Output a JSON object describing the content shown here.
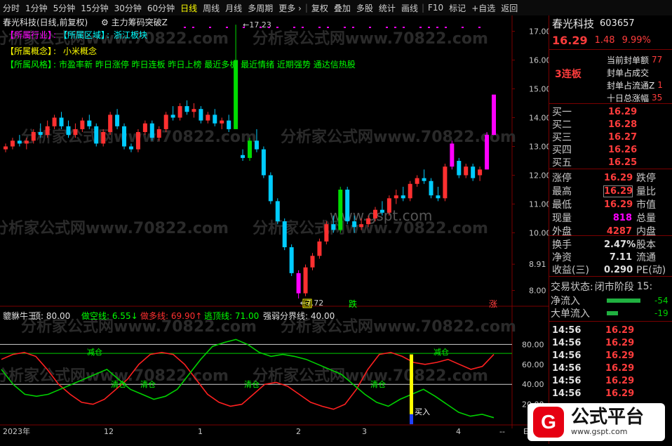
{
  "toolbar": {
    "items": [
      "分时",
      "1分钟",
      "5分钟",
      "15分钟",
      "30分钟",
      "60分钟",
      "日线",
      "周线",
      "月线",
      "多周期",
      "更多",
      "复权",
      "叠加",
      "多股",
      "统计",
      "画线",
      "F10",
      "标记",
      "+自选",
      "返回"
    ],
    "active_index": 6,
    "more_arrow": "›"
  },
  "main_chart": {
    "title": "春光科技(日线,前复权)",
    "indicator_name": "主力筹码突破Z",
    "info_lines": [
      {
        "key": "【所属行业】",
        "sep": ":",
        "key2": "【所属区域】",
        "sep2": ":",
        "value": "浙江板块"
      },
      {
        "key": "【所属概念】",
        "sep": ":",
        "value": "小米概念"
      },
      {
        "key": "【所属风格】",
        "sep": ":",
        "value": "市盈率新 昨日涨停 昨日连板 昨日上榜 最近多板 最近情绪 近期强势 通达信热股"
      }
    ],
    "price_axis": [
      "17.00",
      "16.00",
      "15.00",
      "14.00",
      "13.00",
      "12.00",
      "11.00",
      "10.00",
      "8.91",
      "8.00"
    ],
    "high_label": "17.23",
    "low_label": "7.72",
    "markers": {
      "hui": "回",
      "die": "跌",
      "zhang": "涨"
    },
    "watermarks": [
      "分析家公式网www.70822.com",
      "www.gspt.com"
    ],
    "colors": {
      "up": "#ff3030",
      "down": "#00ccff",
      "limit": "#ff00ff",
      "green": "#00dd00"
    }
  },
  "chart_data": {
    "type": "candlestick",
    "x": [
      "2023年",
      "12",
      "1",
      "2",
      "3",
      "4"
    ],
    "ylim": [
      7.5,
      17.5
    ],
    "high": 17.23,
    "low": 7.72,
    "series": [
      {
        "name": "",
        "values": [
          [
            12.9,
            13.1,
            12.8,
            13.0
          ],
          [
            13.0,
            13.3,
            12.9,
            13.2
          ],
          [
            13.2,
            13.4,
            13.0,
            13.1
          ],
          [
            13.1,
            13.3,
            12.9,
            13.2
          ],
          [
            13.2,
            13.6,
            13.1,
            13.5
          ],
          [
            13.5,
            13.8,
            13.3,
            13.4
          ],
          [
            13.4,
            13.9,
            13.3,
            13.7
          ],
          [
            13.7,
            14.1,
            13.6,
            14.0
          ],
          [
            14.0,
            14.2,
            13.6,
            13.7
          ],
          [
            13.7,
            13.9,
            13.3,
            13.4
          ],
          [
            13.4,
            13.8,
            13.3,
            13.6
          ],
          [
            13.6,
            14.0,
            13.5,
            13.9
          ],
          [
            13.9,
            14.1,
            13.6,
            13.7
          ],
          [
            13.7,
            13.8,
            13.0,
            13.1
          ],
          [
            13.1,
            13.6,
            13.0,
            13.5
          ],
          [
            13.5,
            14.2,
            13.4,
            14.1
          ],
          [
            14.1,
            14.3,
            13.6,
            13.7
          ],
          [
            13.7,
            13.8,
            12.9,
            13.0
          ],
          [
            13.0,
            13.1,
            12.8,
            12.9
          ],
          [
            12.9,
            13.6,
            12.8,
            13.5
          ],
          [
            13.5,
            13.9,
            13.4,
            13.8
          ],
          [
            13.8,
            13.9,
            13.2,
            13.3
          ],
          [
            13.3,
            13.7,
            13.2,
            13.6
          ],
          [
            13.6,
            14.2,
            13.5,
            14.1
          ],
          [
            14.1,
            14.4,
            13.9,
            14.0
          ],
          [
            14.0,
            14.5,
            13.9,
            14.4
          ],
          [
            14.4,
            14.6,
            14.1,
            14.2
          ],
          [
            14.2,
            14.5,
            14.0,
            14.3
          ],
          [
            14.3,
            14.4,
            13.8,
            13.9
          ],
          [
            13.9,
            14.2,
            13.8,
            14.1
          ],
          [
            14.1,
            14.3,
            13.7,
            13.8
          ],
          [
            13.8,
            14.0,
            13.6,
            13.9
          ],
          [
            13.9,
            14.1,
            13.5,
            13.6
          ],
          [
            13.6,
            17.23,
            13.6,
            16.0
          ],
          [
            12.7,
            12.9,
            12.5,
            12.6
          ],
          [
            12.6,
            13.3,
            12.5,
            13.2
          ],
          [
            13.2,
            13.6,
            12.8,
            12.9
          ],
          [
            12.9,
            13.0,
            11.9,
            12.0
          ],
          [
            12.0,
            12.1,
            11.0,
            11.1
          ],
          [
            11.1,
            11.2,
            10.3,
            10.4
          ],
          [
            10.4,
            10.5,
            9.4,
            9.5
          ],
          [
            9.5,
            9.6,
            8.5,
            8.6
          ],
          [
            8.6,
            8.7,
            7.72,
            7.9
          ],
          [
            7.9,
            8.9,
            7.8,
            8.8
          ],
          [
            8.8,
            9.3,
            8.7,
            9.2
          ],
          [
            9.2,
            9.8,
            9.1,
            9.7
          ],
          [
            9.7,
            10.4,
            9.6,
            10.3
          ],
          [
            10.3,
            10.6,
            10.0,
            10.1
          ],
          [
            10.1,
            11.6,
            10.0,
            11.5
          ],
          [
            11.5,
            11.6,
            10.3,
            10.4
          ],
          [
            10.4,
            10.6,
            10.0,
            10.2
          ],
          [
            10.2,
            10.5,
            10.1,
            10.3
          ],
          [
            10.3,
            10.6,
            10.2,
            10.5
          ],
          [
            10.5,
            10.9,
            10.4,
            10.8
          ],
          [
            10.8,
            11.1,
            10.6,
            10.7
          ],
          [
            10.7,
            11.3,
            10.6,
            11.2
          ],
          [
            11.2,
            11.5,
            11.0,
            11.3
          ],
          [
            11.3,
            11.6,
            11.1,
            11.2
          ],
          [
            11.2,
            11.8,
            11.1,
            11.7
          ],
          [
            11.7,
            12.0,
            11.6,
            11.9
          ],
          [
            11.9,
            12.2,
            11.7,
            11.8
          ],
          [
            11.8,
            11.9,
            11.2,
            11.3
          ],
          [
            11.3,
            11.6,
            11.1,
            11.2
          ],
          [
            11.2,
            12.4,
            11.1,
            12.3
          ],
          [
            12.3,
            13.2,
            12.2,
            13.1
          ],
          [
            12.5,
            12.6,
            11.9,
            12.0
          ],
          [
            12.0,
            12.4,
            11.9,
            12.3
          ],
          [
            12.3,
            12.4,
            11.8,
            11.9
          ],
          [
            12.0,
            12.3,
            11.8,
            12.2
          ],
          [
            12.2,
            13.5,
            12.2,
            13.4
          ],
          [
            13.4,
            14.8,
            13.4,
            14.8
          ]
        ]
      }
    ]
  },
  "sub_chart": {
    "name": "貔貅牛王",
    "top_label": "顶: 80.00",
    "short_label": "做空线: 6.55",
    "long_label": "做多线: 69.90",
    "escape_label": "逃顶线: 71.00",
    "strong_label": "强弱分界线: 40.00",
    "axis": [
      "80.00",
      "60.00",
      "40.00",
      "20.00"
    ],
    "annotations": {
      "jiancang": "减仓",
      "qingcang": "清仓",
      "mairu": "买入"
    },
    "chart_data": {
      "type": "line",
      "ylim": [
        0,
        100
      ],
      "series": [
        {
          "name": "做多线",
          "color": "#ff2020",
          "values": [
            65,
            70,
            72,
            68,
            55,
            40,
            30,
            22,
            20,
            25,
            35,
            45,
            60,
            70,
            72,
            70,
            60,
            45,
            30,
            22,
            18,
            20,
            30,
            40,
            42,
            38,
            30,
            22,
            18,
            15,
            20,
            35,
            55,
            70,
            72,
            68,
            62,
            60,
            62,
            65,
            60,
            55,
            58,
            70
          ]
        },
        {
          "name": "做空线",
          "color": "#00d000",
          "values": [
            55,
            40,
            30,
            28,
            30,
            35,
            40,
            45,
            50,
            55,
            45,
            35,
            30,
            25,
            28,
            35,
            50,
            65,
            78,
            82,
            85,
            80,
            72,
            68,
            70,
            68,
            65,
            60,
            55,
            50,
            40,
            30,
            22,
            18,
            25,
            30,
            35,
            28,
            20,
            12,
            8,
            10,
            6.55
          ]
        }
      ]
    }
  },
  "axis_bottom": {
    "labels": [
      "2023年",
      "12",
      "1",
      "2",
      "3",
      "4"
    ],
    "scroll": "--",
    "end": "E"
  },
  "quote_panel": {
    "name": "春光科技",
    "code": "603657",
    "price": "16.29",
    "change": "1.48",
    "change_pct": "9.99%",
    "lianban": "3连板",
    "seal_rows": [
      {
        "label": "当前封单额",
        "value": "77"
      },
      {
        "label": "封单占成交",
        "value": ""
      },
      {
        "label": "封单占流通Z",
        "value": "1"
      },
      {
        "label": "十日总涨幅",
        "value": "35"
      }
    ],
    "bids": [
      {
        "label": "买一",
        "price": "16.29"
      },
      {
        "label": "买二",
        "price": "16.28"
      },
      {
        "label": "买三",
        "price": "16.27"
      },
      {
        "label": "买四",
        "price": "16.26"
      },
      {
        "label": "买五",
        "price": "16.25"
      }
    ],
    "stats": [
      {
        "l1": "涨停",
        "v1": "16.29",
        "l2": "跌停"
      },
      {
        "l1": "最高",
        "v1": "16.29",
        "l2": "量比"
      },
      {
        "l1": "最低",
        "v1": "16.29",
        "l2": "市值"
      },
      {
        "l1": "现量",
        "v1": "818",
        "l2": "总量"
      },
      {
        "l1": "外盘",
        "v1": "4287",
        "l2": "内盘"
      }
    ],
    "stats2": [
      {
        "l1": "换手",
        "v1": "2.47%",
        "l2": "股本"
      },
      {
        "l1": "净资",
        "v1": "7.11",
        "l2": "流通"
      },
      {
        "l1": "收益(三)",
        "v1": "0.290",
        "l2": "PE(动)"
      }
    ],
    "trade_status_label": "交易状态:",
    "trade_status": "闭市阶段",
    "trade_status_time": "15:",
    "flows": [
      {
        "label": "净流入",
        "value": "-54"
      },
      {
        "label": "大单流入",
        "value": "-19"
      }
    ],
    "ticks": [
      {
        "time": "14:56",
        "price": "16.29"
      },
      {
        "time": "14:56",
        "price": "16.29"
      },
      {
        "time": "14:56",
        "price": "16.29"
      },
      {
        "time": "14:56",
        "price": "16.29"
      },
      {
        "time": "14:56",
        "price": "16.29"
      },
      {
        "time": "14:56",
        "price": "16.29"
      }
    ]
  },
  "logo": {
    "text": "公式平台",
    "url": "www.gspt.com",
    "mark": "G"
  }
}
